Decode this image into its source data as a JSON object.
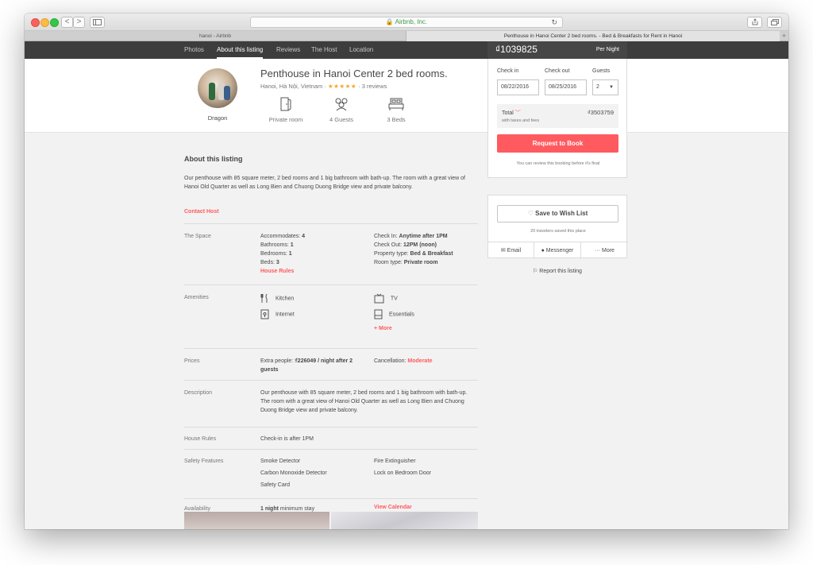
{
  "browser": {
    "url": "Airbnb, Inc.",
    "back": "<",
    "forward": ">",
    "tabs": [
      {
        "label": "hanoi - Airbnb"
      },
      {
        "label": "Penthouse in Hanoi Center 2 bed rooms. - Bed & Breakfasts for Rent in Hanoi"
      }
    ],
    "new_tab": "+"
  },
  "subnav": {
    "items": [
      "Photos",
      "About this listing",
      "Reviews",
      "The Host",
      "Location"
    ],
    "active": "About this listing"
  },
  "listing": {
    "host_name": "Dragon",
    "title": "Penthouse in Hanoi Center 2 bed rooms.",
    "location": "Hanoi, Hà Nội, Vietnam ·",
    "stars": "★★★★★",
    "reviews": "· 3 reviews",
    "features": [
      {
        "label": "Private room",
        "icon": "door-icon"
      },
      {
        "label": "4 Guests",
        "icon": "guests-icon"
      },
      {
        "label": "3 Beds",
        "icon": "bed-icon"
      }
    ]
  },
  "about": {
    "heading": "About this listing",
    "summary": "Our penthouse with 85 square meter, 2 bed rooms and 1 big bathroom with bath-up. The room with a great view of Hanoi Old Quarter as well as Long Bien and Chuong Duong Bridge view and private balcony.",
    "contact_host": "Contact Host"
  },
  "space": {
    "label": "The Space",
    "left": [
      {
        "k": "Accommodates: ",
        "v": "4"
      },
      {
        "k": "Bathrooms: ",
        "v": "1"
      },
      {
        "k": "Bedrooms: ",
        "v": "1"
      },
      {
        "k": "Beds: ",
        "v": "3"
      }
    ],
    "house_rules_link": "House Rules",
    "right": [
      {
        "k": "Check In: ",
        "v": "Anytime after 1PM"
      },
      {
        "k": "Check Out: ",
        "v": "12PM (noon)"
      },
      {
        "k": "Property type: ",
        "v": "Bed & Breakfast"
      },
      {
        "k": "Room type: ",
        "v": "Private room"
      }
    ]
  },
  "amenities": {
    "label": "Amenities",
    "items": [
      "Kitchen",
      "TV",
      "Internet",
      "Essentials"
    ],
    "more": "+ More"
  },
  "prices": {
    "label": "Prices",
    "extra_people_k": "Extra people: ",
    "extra_people_v": "₫226049 / night after 2 guests",
    "cancellation_k": "Cancellation: ",
    "cancellation_v": "Moderate"
  },
  "description": {
    "label": "Description",
    "text": "Our penthouse with 85 square meter, 2 bed rooms and 1 big bathroom with bath-up. The room with a great view of Hanoi Old Quarter as well as Long Bien and Chuong Duong Bridge view and private balcony."
  },
  "house_rules": {
    "label": "House Rules",
    "text": "Check-in is after 1PM"
  },
  "safety": {
    "label": "Safety Features",
    "items": [
      "Smoke Detector",
      "Fire Extinguisher",
      "Carbon Monoxide Detector",
      "Lock on Bedroom Door",
      "Safety Card"
    ]
  },
  "availability": {
    "label": "Availability",
    "min_stay_bold": "1 night",
    "min_stay_rest": " minimum stay",
    "calendar_link": "View Calendar"
  },
  "booking": {
    "price": "₫1039825",
    "per_night": "Per Night",
    "checkin_label": "Check in",
    "checkout_label": "Check out",
    "guests_label": "Guests",
    "checkin_value": "08/22/2016",
    "checkout_value": "08/25/2016",
    "guests_value": "2",
    "total_label": "Total",
    "total_sub": "with taxes and fees",
    "total_amount": "₫3503759",
    "request_button": "Request to Book",
    "note": "You can review this booking before it's final"
  },
  "wishlist": {
    "button": "Save to Wish List",
    "saved": "20 travelers saved this place",
    "share": [
      "Email",
      "Messenger",
      "··· More"
    ],
    "report": "Report this listing"
  },
  "colors": {
    "accent": "#ff5a5f",
    "dark_nav": "#3d3d3d",
    "stars": "#f5a623"
  }
}
